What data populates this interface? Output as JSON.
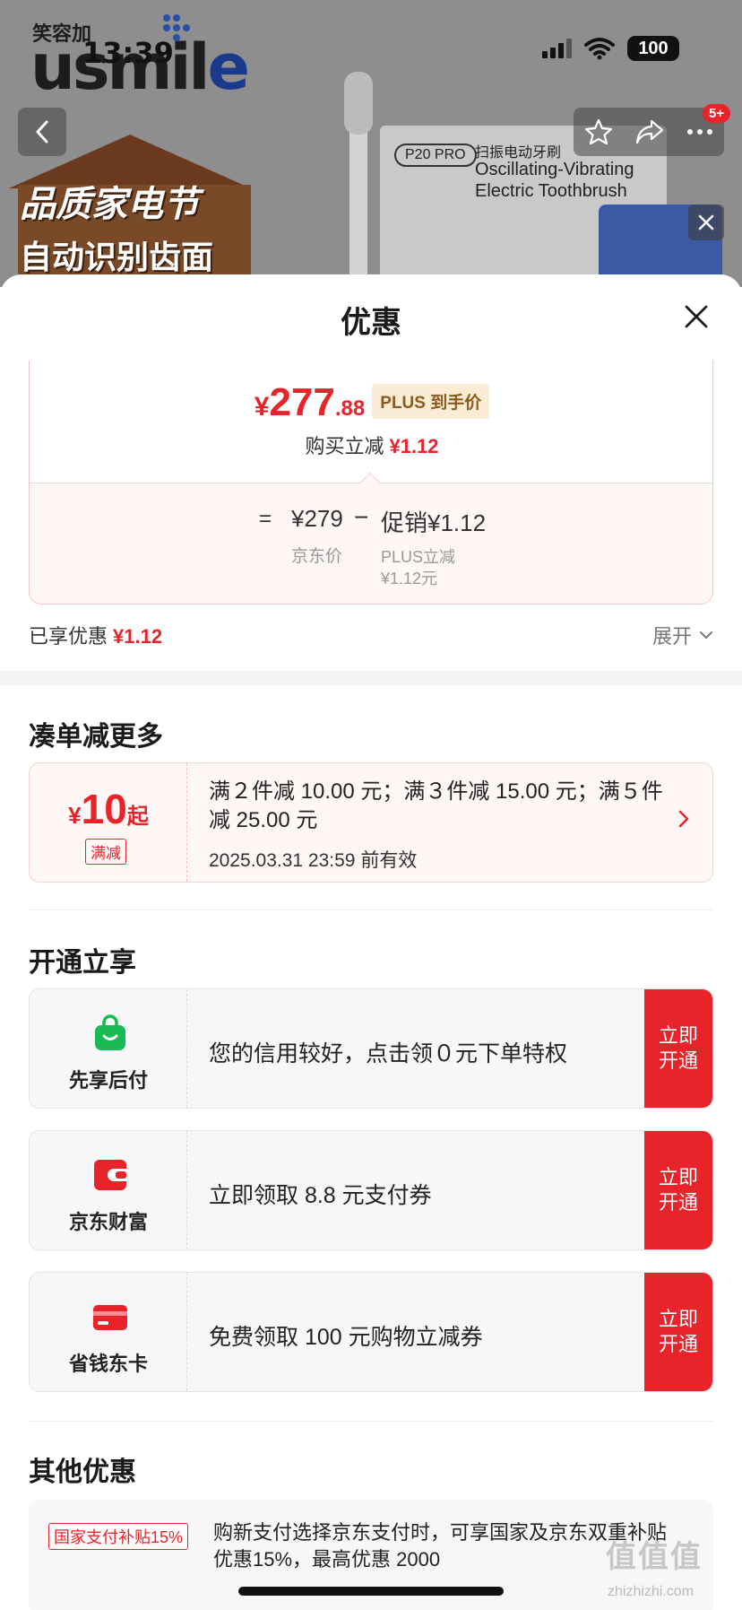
{
  "status_bar": {
    "time": "13:39",
    "battery": "100"
  },
  "background": {
    "brand_cn": "笑容加",
    "brand_en_a": "usmil",
    "brand_en_b": "e",
    "cart_badge": "5+",
    "promo_line1": "品质家电节",
    "promo_line2": "自动识别齿面",
    "product_model": "P20 PRO",
    "product_line1": "扫振电动牙刷",
    "product_line2": "Oscillating-Vibrating",
    "product_line3": "Electric Toothbrush"
  },
  "sheet": {
    "title": "优惠",
    "price": {
      "currency": "¥",
      "integer": "277",
      "decimal": ".88",
      "tag": "PLUS 到手价",
      "buy_cut_label": "购买立减",
      "buy_cut_value": "¥1.12"
    },
    "calc": {
      "equals": "=",
      "jd_price": "¥279",
      "minus": "−",
      "promo": "促销¥1.12",
      "jd_price_label": "京东价",
      "plus_cut_label": "PLUS立减",
      "plus_cut_value": "¥1.12元"
    },
    "enjoyed_label": "已享优惠",
    "enjoyed_value": "¥1.12",
    "expand_label": "展开",
    "section_bundle": "凑单减更多",
    "coupon": {
      "currency": "¥",
      "value": "10",
      "suffix": "起",
      "tag": "满减",
      "text": "满２件减 10.00 元；满３件减 15.00 元；满５件减 25.00 元",
      "validity": "2025.03.31 23:59 前有效"
    },
    "section_open": "开通立享",
    "services": [
      {
        "name": "先享后付",
        "text": "您的信用较好，点击领０元下单特权",
        "button": "立即开通",
        "icon": "shopping-bag-icon"
      },
      {
        "name": "京东财富",
        "text": "立即领取 8.8 元支付券",
        "button": "立即开通",
        "icon": "wallet-icon"
      },
      {
        "name": "省钱东卡",
        "text": "免费领取 100 元购物立减券",
        "button": "立即开通",
        "icon": "card-icon"
      }
    ],
    "section_other": "其他优惠",
    "other": {
      "tag": "国家支付补贴15%",
      "text": "购新支付选择京东支付时，可享国家及京东双重补贴优惠15%，最高优惠 2000"
    }
  },
  "watermark": {
    "mark": "值值值",
    "url": "zhizhizhi.com"
  },
  "colors": {
    "accent_red": "#e8232a",
    "service_green": "#19b955",
    "plus_gold": "#8a5a1e"
  }
}
